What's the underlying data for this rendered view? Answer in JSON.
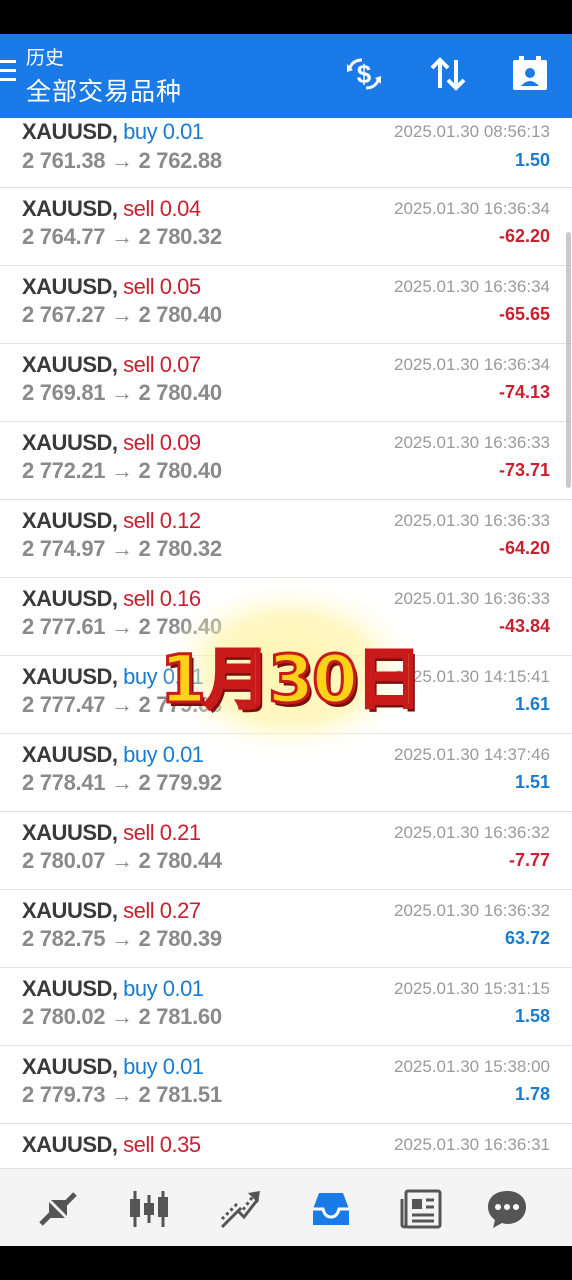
{
  "header": {
    "subtitle": "历史",
    "title": "全部交易品种",
    "accent_color": "#1a7be8",
    "icons": [
      "menu-icon",
      "currency-exchange-icon",
      "sort-icon",
      "calendar-icon"
    ]
  },
  "trades": [
    {
      "symbol": "XAUUSD,",
      "type": "buy 0.01",
      "side": "buy",
      "prices": "2 761.38 → 2 762.88",
      "time": "2025.01.30 08:56:13",
      "profit": "1.50",
      "positive": true
    },
    {
      "symbol": "XAUUSD,",
      "type": "sell 0.04",
      "side": "sell",
      "prices": "2 764.77 → 2 780.32",
      "time": "2025.01.30 16:36:34",
      "profit": "-62.20",
      "positive": false
    },
    {
      "symbol": "XAUUSD,",
      "type": "sell 0.05",
      "side": "sell",
      "prices": "2 767.27 → 2 780.40",
      "time": "2025.01.30 16:36:34",
      "profit": "-65.65",
      "positive": false
    },
    {
      "symbol": "XAUUSD,",
      "type": "sell 0.07",
      "side": "sell",
      "prices": "2 769.81 → 2 780.40",
      "time": "2025.01.30 16:36:34",
      "profit": "-74.13",
      "positive": false
    },
    {
      "symbol": "XAUUSD,",
      "type": "sell 0.09",
      "side": "sell",
      "prices": "2 772.21 → 2 780.40",
      "time": "2025.01.30 16:36:33",
      "profit": "-73.71",
      "positive": false
    },
    {
      "symbol": "XAUUSD,",
      "type": "sell 0.12",
      "side": "sell",
      "prices": "2 774.97 → 2 780.32",
      "time": "2025.01.30 16:36:33",
      "profit": "-64.20",
      "positive": false
    },
    {
      "symbol": "XAUUSD,",
      "type": "sell 0.16",
      "side": "sell",
      "prices": "2 777.61 → 2 780.40",
      "time": "2025.01.30 16:36:33",
      "profit": "-43.84",
      "positive": false
    },
    {
      "symbol": "XAUUSD,",
      "type": "buy 0.01",
      "side": "buy",
      "prices": "2 777.47 → 2 779.08",
      "time": "2025.01.30 14:15:41",
      "profit": "1.61",
      "positive": true
    },
    {
      "symbol": "XAUUSD,",
      "type": "buy 0.01",
      "side": "buy",
      "prices": "2 778.41 → 2 779.92",
      "time": "2025.01.30 14:37:46",
      "profit": "1.51",
      "positive": true
    },
    {
      "symbol": "XAUUSD,",
      "type": "sell 0.21",
      "side": "sell",
      "prices": "2 780.07 → 2 780.44",
      "time": "2025.01.30 16:36:32",
      "profit": "-7.77",
      "positive": false
    },
    {
      "symbol": "XAUUSD,",
      "type": "sell 0.27",
      "side": "sell",
      "prices": "2 782.75 → 2 780.39",
      "time": "2025.01.30 16:36:32",
      "profit": "63.72",
      "positive": true
    },
    {
      "symbol": "XAUUSD,",
      "type": "buy 0.01",
      "side": "buy",
      "prices": "2 780.02 → 2 781.60",
      "time": "2025.01.30 15:31:15",
      "profit": "1.58",
      "positive": true
    },
    {
      "symbol": "XAUUSD,",
      "type": "buy 0.01",
      "side": "buy",
      "prices": "2 779.73 → 2 781.51",
      "time": "2025.01.30 15:38:00",
      "profit": "1.78",
      "positive": true
    },
    {
      "symbol": "XAUUSD,",
      "type": "sell 0.35",
      "side": "sell",
      "prices": "",
      "time": "2025.01.30 16:36:31",
      "profit": "",
      "positive": false
    }
  ],
  "sticker": {
    "text": "1月30日"
  },
  "bottom_nav": {
    "items": [
      "quotes-icon",
      "chart-icon",
      "trade-icon",
      "history-icon",
      "news-icon",
      "chat-icon"
    ],
    "active_index": 3,
    "active_color": "#1a7be8",
    "inactive_color": "#555555"
  },
  "colors": {
    "buy": "#1a7ccf",
    "sell": "#c8202f"
  }
}
